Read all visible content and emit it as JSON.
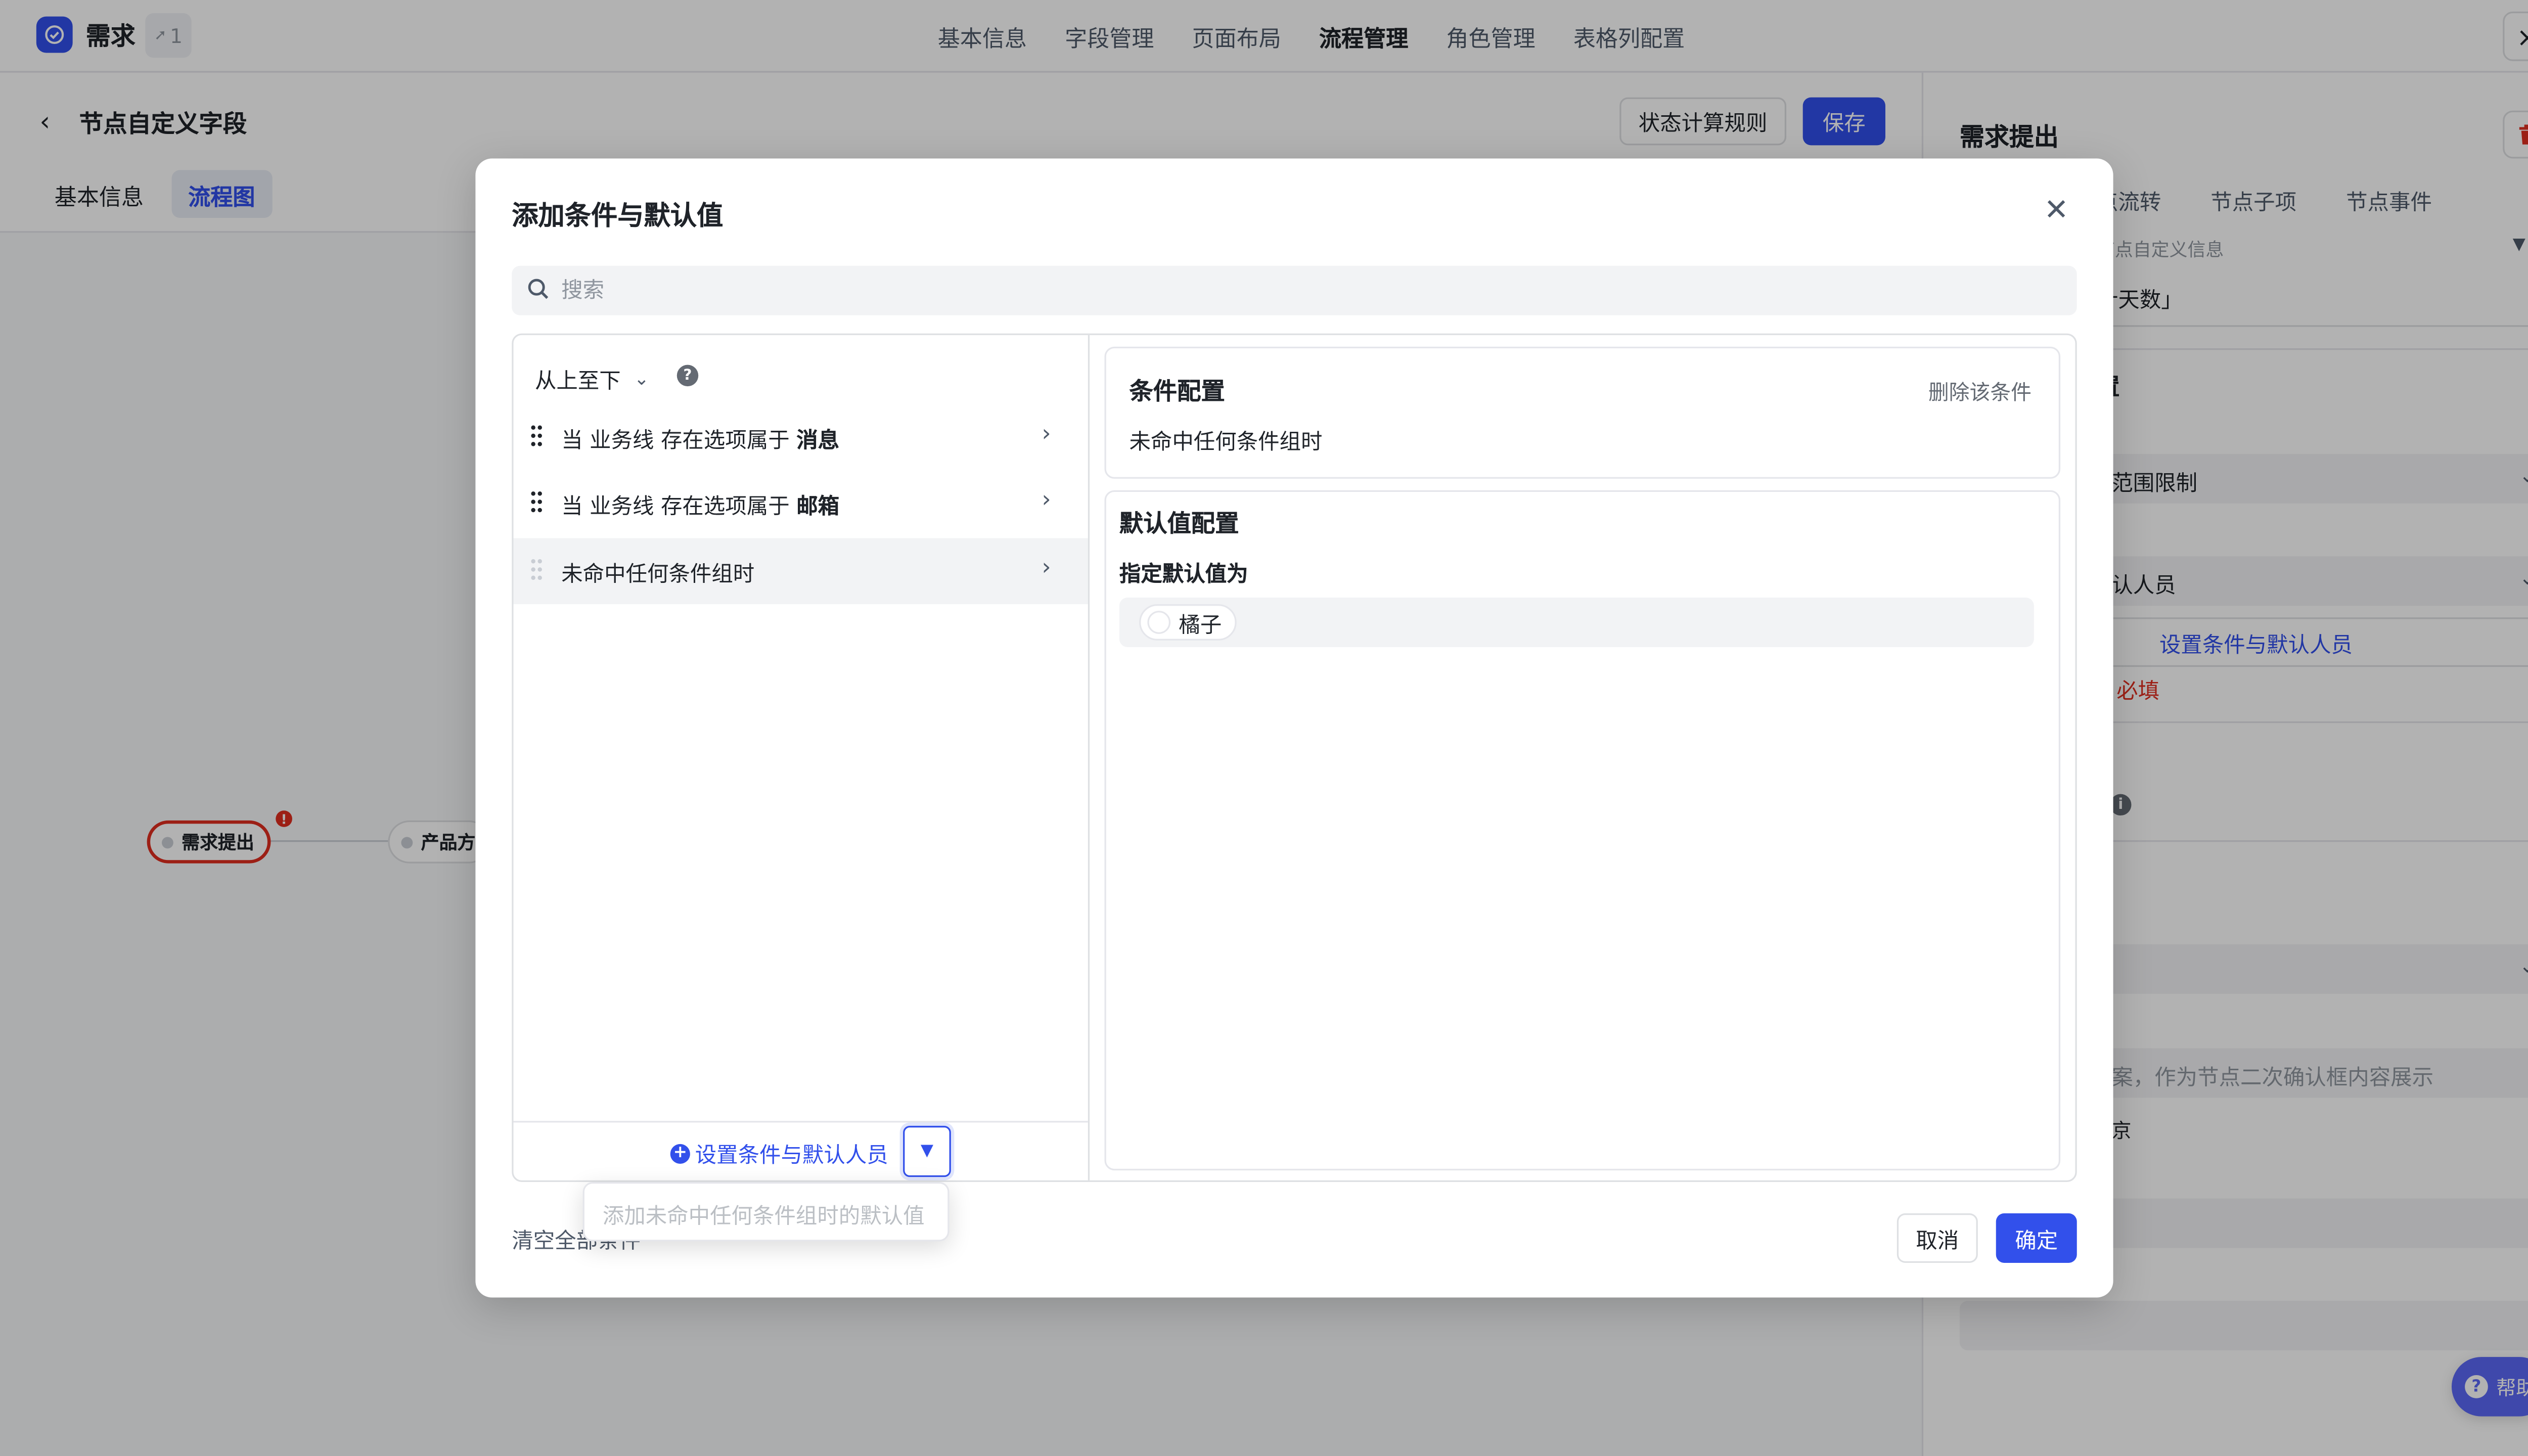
{
  "app": {
    "title": "需求",
    "share_count": "1",
    "nav": [
      "基本信息",
      "字段管理",
      "页面布局",
      "流程管理",
      "角色管理",
      "表格列配置"
    ],
    "close_icon": "×"
  },
  "subheader": {
    "back_icon": "‹",
    "title": "节点自定义字段",
    "status_rules_button": "状态计算规则",
    "save_button": "保存",
    "tabs": [
      "基本信息",
      "流程图"
    ]
  },
  "flow": {
    "nodes": [
      "需求提出",
      "产品方"
    ],
    "error_mark": "!"
  },
  "right_panel": {
    "title": "需求提出",
    "tabs": [
      "点流转",
      "节点子项",
      "节点事件"
    ],
    "card_sub": "节点自定义信息",
    "card_value": "计天数」",
    "section_head": "置",
    "select_1": "范围限制",
    "select_2": "认人员",
    "link_button": "设置条件与默认人员",
    "required_text": "必填",
    "placeholder_text": "案，作为节点二次确认框内容展示",
    "small_text": "京"
  },
  "help_button": "帮助",
  "modal": {
    "title": "添加条件与默认值",
    "search_placeholder": "搜索",
    "order_label": "从上至下",
    "conditions": [
      {
        "prefix": "当 业务线 存在选项属于 ",
        "value": "消息"
      },
      {
        "prefix": "当 业务线 存在选项属于 ",
        "value": "邮箱"
      },
      {
        "prefix": "未命中任何条件组时",
        "value": ""
      }
    ],
    "add_button": "设置条件与默认人员",
    "dropdown_option": "添加未命中任何条件组时的默认值",
    "clear_all": "清空全部条件",
    "config": {
      "title": "条件配置",
      "delete_link": "删除该条件",
      "condition_text": "未命中任何条件组时"
    },
    "default": {
      "title": "默认值配置",
      "label": "指定默认值为",
      "person": "橘子"
    },
    "cancel_button": "取消",
    "ok_button": "确定"
  },
  "colors": {
    "accent": "#3250eb",
    "error": "#e02d1f",
    "help": "#5b67f5"
  }
}
